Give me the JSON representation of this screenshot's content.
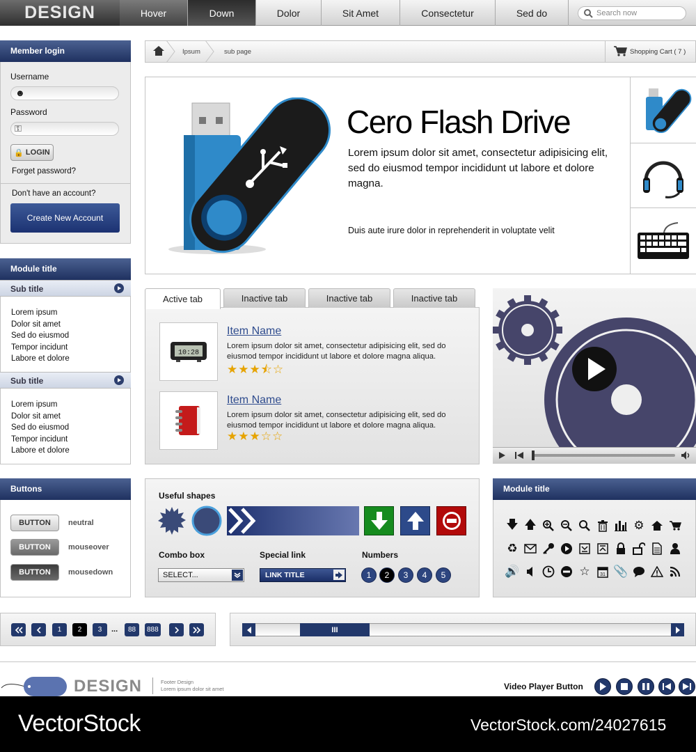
{
  "nav": {
    "logo": "DESIGN",
    "items": [
      "Hover",
      "Down",
      "Dolor",
      "Sit Amet",
      "Consectetur",
      "Sed do"
    ],
    "search_placeholder": "Search now"
  },
  "login": {
    "title": "Member login",
    "username_label": "Username",
    "password_label": "Password",
    "login_button": "LOGIN",
    "forget": "Forget password?",
    "no_account": "Don't have an account?",
    "create": "Create New Account"
  },
  "module1": {
    "title": "Module title",
    "sub1": "Sub title",
    "list1": [
      "Lorem ipsum",
      "Dolor sit amet",
      "Sed do eiusmod",
      "Tempor incidunt",
      "Labore et dolore"
    ],
    "sub2": "Sub title",
    "list2": [
      "Lorem ipsum",
      "Dolor sit amet",
      "Sed do eiusmod",
      "Tempor incidunt",
      "Labore et dolore"
    ]
  },
  "buttons": {
    "title": "Buttons",
    "label": "BUTTON",
    "states": [
      "neutral",
      "mouseover",
      "mousedown"
    ]
  },
  "breadcrumb": {
    "items": [
      "Ipsum",
      "sub page"
    ],
    "cart": "Shopping Cart ( 7 )"
  },
  "hero": {
    "title": "Cero Flash Drive",
    "text": "Lorem ipsum dolor sit amet, consectetur adipisicing elit, sed do eiusmod tempor incididunt ut labore et dolore magna.",
    "small": "Duis aute irure dolor in reprehenderit in voluptate velit"
  },
  "tabs": [
    "Active tab",
    "Inactive tab",
    "Inactive tab",
    "Inactive tab"
  ],
  "items": [
    {
      "name": "Item Name",
      "desc": "Lorem ipsum dolor sit amet, consectetur adipisicing elit, sed do eiusmod tempor incididunt ut labore et dolore magna aliqua.",
      "stars": "★★★⯪☆",
      "clock": "10:28"
    },
    {
      "name": "Item Name",
      "desc": "Lorem ipsum dolor sit amet, consectetur adipisicing elit, sed do eiusmod tempor incididunt ut labore et dolore magna aliqua.",
      "stars": "★★★☆☆"
    }
  ],
  "shapes": {
    "title": "Useful shapes",
    "combo_label": "Combo box",
    "combo_value": "SELECT...",
    "link_label": "Special link",
    "link_value": "LINK TITLE",
    "numbers_label": "Numbers",
    "numbers": [
      "1",
      "2",
      "3",
      "4",
      "5"
    ]
  },
  "module2": {
    "title": "Module title"
  },
  "pagination": [
    "1",
    "2",
    "3",
    "...",
    "88",
    "888"
  ],
  "footer": {
    "logo": "DESIGN",
    "small1": "Footer Design",
    "small2": "Lorem ipsum dolor sit amet",
    "vp_label": "Video Player Button"
  },
  "watermark": {
    "left": "VectorStock",
    "right": "VectorStock.com/24027615"
  },
  "colors": {
    "accent": "#22386b",
    "star": "#e6a300"
  }
}
